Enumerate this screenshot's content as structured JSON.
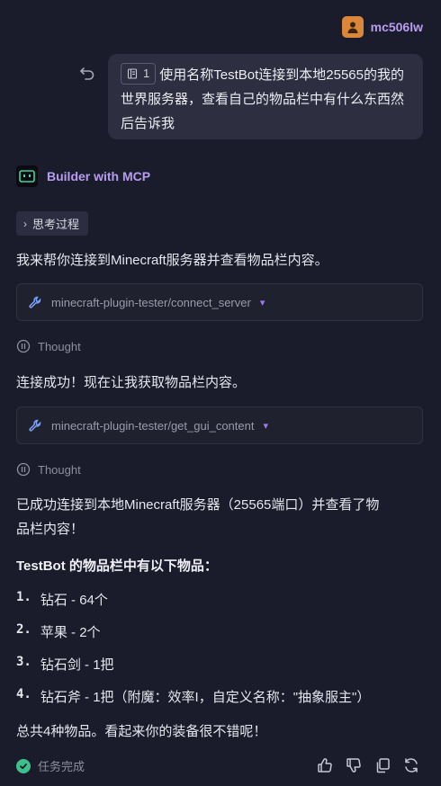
{
  "user": {
    "name": "mc506lw"
  },
  "message": {
    "ref_count": "1",
    "text": "使用名称TestBot连接到本地25565的我的世界服务器，查看自己的物品栏中有什么东西然后告诉我"
  },
  "assistant": {
    "name": "Builder with MCP",
    "thinking_label": "思考过程",
    "intro": "我来帮你连接到Minecraft服务器并查看物品栏内容。",
    "tool1": "minecraft-plugin-tester/connect_server",
    "thought1": "Thought",
    "connected": "连接成功！现在让我获取物品栏内容。",
    "tool2": "minecraft-plugin-tester/get_gui_content",
    "thought2": "Thought",
    "result_line1": "已成功连接到本地Minecraft服务器（25565端口）并查看了物",
    "result_line2": "品栏内容！",
    "summary_title": "TestBot 的物品栏中有以下物品：",
    "items": [
      {
        "num": "1.",
        "text": "钻石 - 64个"
      },
      {
        "num": "2.",
        "text": "苹果 - 2个"
      },
      {
        "num": "3.",
        "text": "钻石剑 - 1把"
      },
      {
        "num": "4.",
        "text": "钻石斧 - 1把（附魔：效率I，自定义名称：\"抽象服主\"）"
      }
    ],
    "closing": "总共4种物品。看起来你的装备很不错呢！"
  },
  "status": {
    "text": "任务完成"
  },
  "colors": {
    "accent": "#b79cf0",
    "success": "#3fbf8a",
    "avatar": "#d9883a"
  }
}
